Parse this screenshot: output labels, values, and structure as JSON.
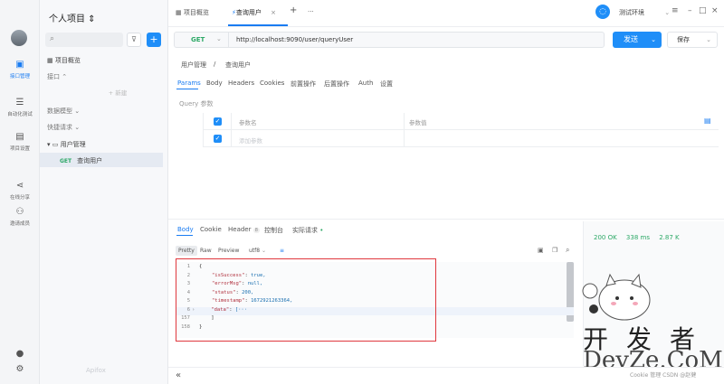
{
  "rail": {
    "items": [
      {
        "label": "接口管理",
        "icon": "api-icon"
      },
      {
        "label": "自动化测试",
        "icon": "automation-icon"
      },
      {
        "label": "项目设置",
        "icon": "settings-icon"
      },
      {
        "label": "在线分享",
        "icon": "share-icon"
      },
      {
        "label": "邀请成员",
        "icon": "invite-icon"
      }
    ]
  },
  "sidebar": {
    "project_title": "个人项目 ⇕",
    "overview": "项目概览",
    "interfaces": "接口 ⌃",
    "new_label": "+ 新建",
    "data_models": "数据模型 ⌄",
    "quick_requests": "快捷请求 ⌄",
    "folder": "用户管理",
    "request_method": "GET",
    "request_name": "查询用户",
    "brand": "Apifox"
  },
  "topbar": {
    "tabs": [
      "项目概览",
      "查询用户"
    ],
    "add": "+",
    "more": "···",
    "env_name": "测试环境",
    "close_tab": "×"
  },
  "request": {
    "method": "GET",
    "url": "http://localhost:9090/user/queryUser",
    "send_label": "发送",
    "save_label": "保存",
    "breadcrumb": [
      "用户管理",
      "/",
      "查询用户"
    ],
    "tabs": [
      "Params",
      "Body",
      "Headers",
      "Cookies",
      "前置操作",
      "后置操作",
      "Auth",
      "设置"
    ],
    "section_label": "Query 参数",
    "col_name": "参数名",
    "col_value": "参数值",
    "add_param_placeholder": "添加参数"
  },
  "response": {
    "tabs": [
      "Body",
      "Cookie",
      "Header",
      "控制台",
      "实际请求"
    ],
    "header_count": "8",
    "format_tabs": [
      "Pretty",
      "Raw",
      "Preview"
    ],
    "encoding": "utf8",
    "status": "200 OK",
    "time": "338 ms",
    "size": "2.87 K",
    "code_lines": [
      {
        "n": "1",
        "text": "{"
      },
      {
        "n": "2",
        "key": "\"isSuccess\"",
        "val": "true,"
      },
      {
        "n": "3",
        "key": "\"errorMsg\"",
        "val": "null,"
      },
      {
        "n": "4",
        "key": "\"status\"",
        "val": "200,"
      },
      {
        "n": "5",
        "key": "\"timestamp\"",
        "val": "1672921263364,"
      },
      {
        "n": "6",
        "key": "\"data\"",
        "val": "[···"
      },
      {
        "n": "157",
        "text": "    ]"
      },
      {
        "n": "158",
        "text": "}"
      }
    ]
  },
  "watermark": {
    "cn": "开发者",
    "en": "DevZe.CoM"
  },
  "footer": {
    "collapse": "«",
    "note": "Cookie 管理 CSDN @赵健"
  }
}
